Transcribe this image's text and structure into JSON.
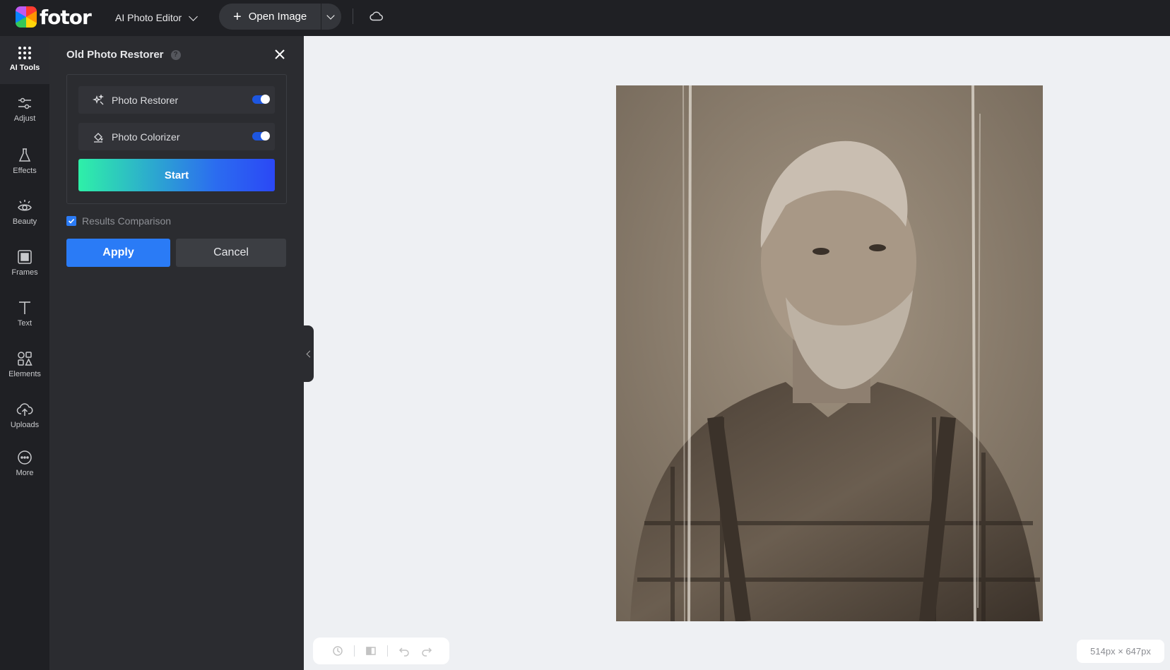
{
  "app": {
    "logo_text": "fotor",
    "editor_menu_label": "AI Photo Editor",
    "open_image_label": "Open Image"
  },
  "rail": {
    "items": [
      {
        "label": "AI Tools",
        "icon": "grid-dots-icon",
        "active": true
      },
      {
        "label": "Adjust",
        "icon": "sliders-icon"
      },
      {
        "label": "Effects",
        "icon": "flask-icon"
      },
      {
        "label": "Beauty",
        "icon": "eye-icon"
      },
      {
        "label": "Frames",
        "icon": "frame-icon"
      },
      {
        "label": "Text",
        "icon": "text-t-icon"
      },
      {
        "label": "Elements",
        "icon": "shapes-icon"
      },
      {
        "label": "Uploads",
        "icon": "cloud-upload-icon"
      },
      {
        "label": "More",
        "icon": "more-dots-icon"
      }
    ]
  },
  "panel": {
    "title": "Old Photo Restorer",
    "tools": [
      {
        "label": "Photo Restorer",
        "enabled": true,
        "icon": "sparkle-icon"
      },
      {
        "label": "Photo Colorizer",
        "enabled": true,
        "icon": "paint-bucket-icon"
      }
    ],
    "start_label": "Start",
    "comparison_label": "Results Comparison",
    "comparison_checked": true,
    "apply_label": "Apply",
    "cancel_label": "Cancel"
  },
  "canvas": {
    "image_size": "514px × 647px"
  },
  "colors": {
    "topbar": "#1f2024",
    "panel": "#2b2c30",
    "accent": "#2a7bf6",
    "canvas_bg": "#eef0f3"
  }
}
